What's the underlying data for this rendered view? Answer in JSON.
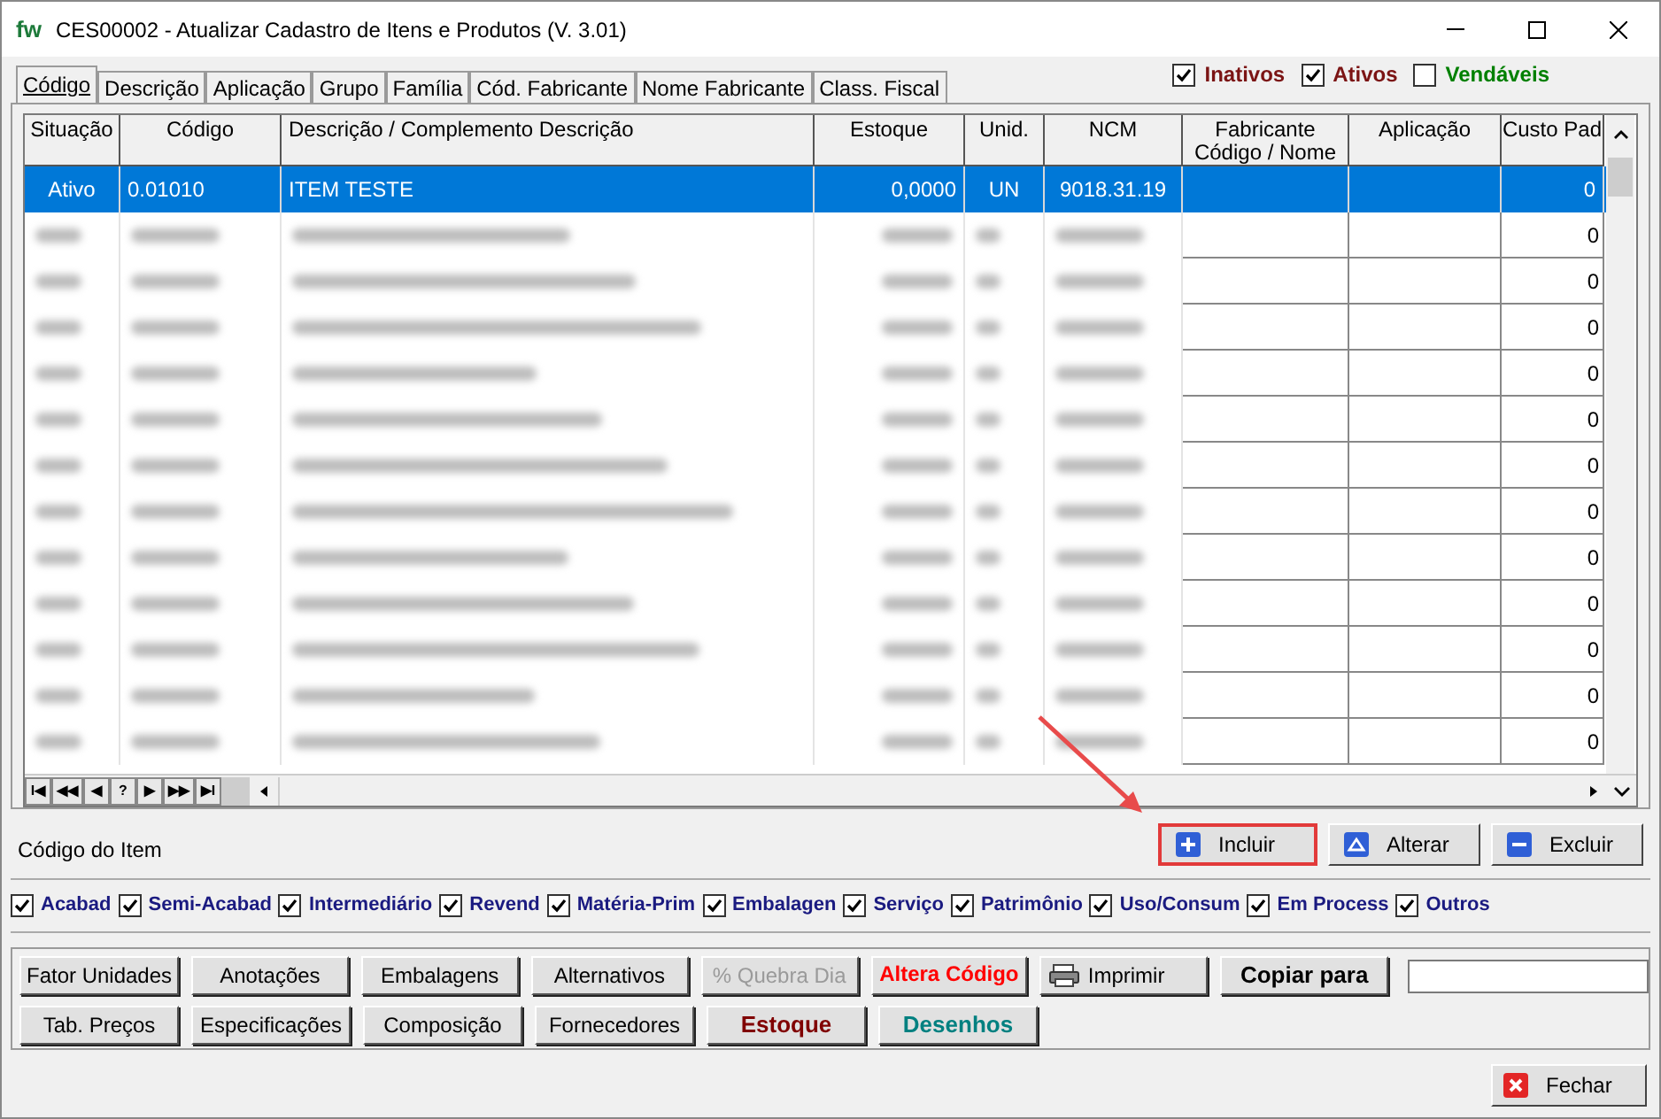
{
  "window": {
    "logo": "fw",
    "title": "CES00002 - Atualizar Cadastro de Itens e Produtos  (V. 3.01)"
  },
  "tabs": [
    {
      "label": "Código",
      "selected": true
    },
    {
      "label": "Descrição",
      "selected": false
    },
    {
      "label": "Aplicação",
      "selected": false
    },
    {
      "label": "Grupo",
      "selected": false
    },
    {
      "label": "Família",
      "selected": false
    },
    {
      "label": "Cód. Fabricante",
      "selected": false
    },
    {
      "label": "Nome Fabricante",
      "selected": false
    },
    {
      "label": "Class. Fiscal",
      "selected": false
    }
  ],
  "filters": [
    {
      "label": "Inativos",
      "checked": true,
      "color": "#7b1414"
    },
    {
      "label": "Ativos",
      "checked": true,
      "color": "#7b1414"
    },
    {
      "label": "Vendáveis",
      "checked": false,
      "color": "#008000"
    }
  ],
  "table": {
    "columns": [
      "Situação",
      "Código",
      "Descrição / Complemento Descrição",
      "Estoque",
      "Unid.",
      "NCM",
      "Fabricante Código / Nome",
      "Aplicação",
      "Custo Pad"
    ],
    "rows": [
      {
        "kind": "text",
        "selected": true,
        "cells": [
          "Ativo",
          "0.01010",
          "ITEM TESTE",
          "0,0000",
          "UN",
          "9018.31.19"
        ],
        "custo_pad": "0"
      },
      {
        "kind": "blurred",
        "selected": false,
        "custo_pad": "0"
      },
      {
        "kind": "blurred",
        "selected": false,
        "custo_pad": "0"
      },
      {
        "kind": "blurred",
        "selected": false,
        "custo_pad": "0"
      },
      {
        "kind": "blurred",
        "selected": false,
        "custo_pad": "0"
      },
      {
        "kind": "blurred",
        "selected": false,
        "custo_pad": "0"
      },
      {
        "kind": "blurred",
        "selected": false,
        "custo_pad": "0"
      },
      {
        "kind": "blurred",
        "selected": false,
        "custo_pad": "0"
      },
      {
        "kind": "blurred",
        "selected": false,
        "custo_pad": "0"
      },
      {
        "kind": "blurred",
        "selected": false,
        "custo_pad": "0"
      },
      {
        "kind": "blurred",
        "selected": false,
        "custo_pad": "0"
      },
      {
        "kind": "blurred",
        "selected": false,
        "custo_pad": "0"
      },
      {
        "kind": "blurred",
        "selected": false,
        "custo_pad": "0"
      }
    ],
    "navigator": [
      "I◀",
      "◀◀",
      "◀",
      "?",
      "▶",
      "▶▶",
      "▶I"
    ]
  },
  "field_label": "Código do Item",
  "record_buttons": [
    {
      "label": "Incluir",
      "kind": "add",
      "highlighted": true
    },
    {
      "label": "Alterar",
      "kind": "edit",
      "highlighted": false
    },
    {
      "label": "Excluir",
      "kind": "delete",
      "highlighted": false
    }
  ],
  "categories": [
    {
      "label": "Acabad",
      "checked": true
    },
    {
      "label": "Semi-Acabad",
      "checked": true
    },
    {
      "label": "Intermediário",
      "checked": true
    },
    {
      "label": "Revend",
      "checked": true
    },
    {
      "label": "Matéria-Prim",
      "checked": true
    },
    {
      "label": "Embalagen",
      "checked": true
    },
    {
      "label": "Serviço",
      "checked": true
    },
    {
      "label": "Patrimônio",
      "checked": true
    },
    {
      "label": "Uso/Consum",
      "checked": true
    },
    {
      "label": "Em Process",
      "checked": true
    },
    {
      "label": "Outros",
      "checked": true
    }
  ],
  "action_rows": [
    [
      {
        "label": "Fator Unidades",
        "kind": "normal"
      },
      {
        "label": "Anotações",
        "kind": "normal"
      },
      {
        "label": "Embalagens",
        "kind": "normal"
      },
      {
        "label": "Alternativos",
        "kind": "normal"
      },
      {
        "label": "% Quebra Dia",
        "kind": "disabled"
      },
      {
        "label": "Altera Código",
        "kind": "flat",
        "color": "#ff0000"
      },
      {
        "label": "Imprimir",
        "kind": "print"
      },
      {
        "label": "Copiar para",
        "kind": "bold",
        "color": "#000000"
      },
      {
        "kind": "input"
      }
    ],
    [
      {
        "label": "Tab. Preços",
        "kind": "normal"
      },
      {
        "label": "Especificações",
        "kind": "normal"
      },
      {
        "label": "Composição",
        "kind": "normal"
      },
      {
        "label": "Fornecedores",
        "kind": "normal"
      },
      {
        "label": "Estoque",
        "kind": "bold",
        "color": "#800000"
      },
      {
        "label": "Desenhos",
        "kind": "bold",
        "color": "#008080"
      }
    ]
  ],
  "close_button": {
    "label": "Fechar"
  }
}
